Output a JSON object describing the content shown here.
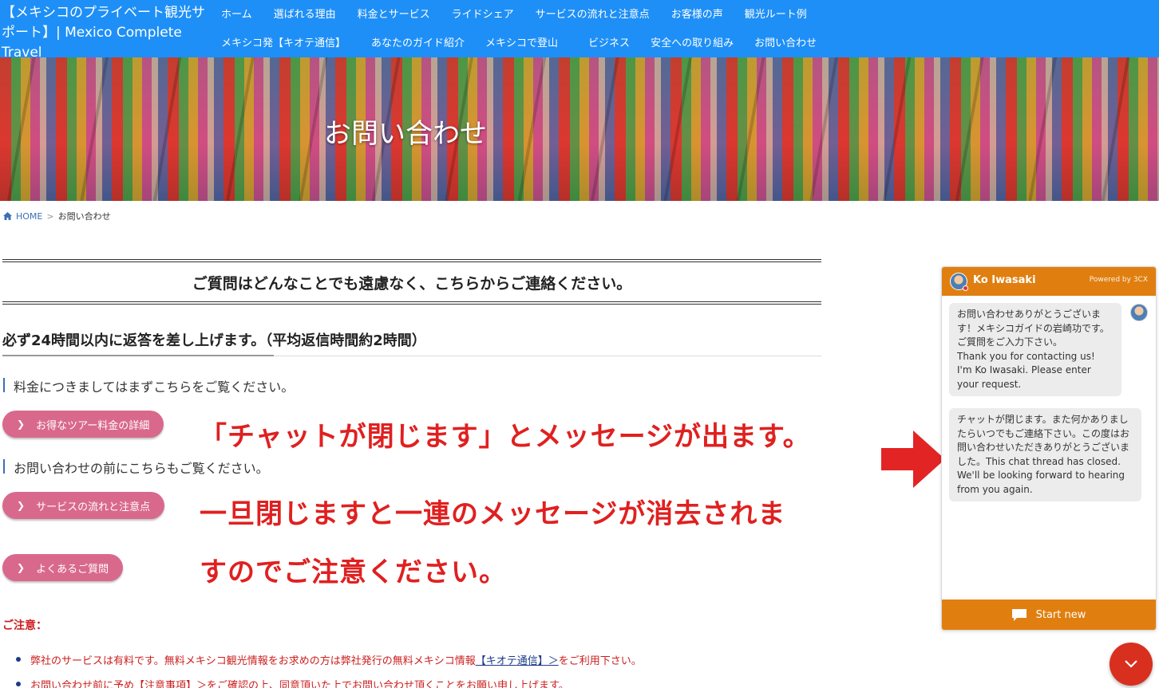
{
  "header": {
    "site_title": "【メキシコのプライベート観光サポート】| Mexico Complete Travel",
    "nav_row1": [
      "ホーム",
      "選ばれる理由",
      "料金とサービス",
      "ライドシェア",
      "サービスの流れと注意点",
      "お客様の声",
      "観光ルート例"
    ],
    "nav_row2": [
      "メキシコ発【キオテ通信】",
      "あなたのガイド紹介",
      "メキシコで登山",
      "ビジネス",
      "安全への取り組み",
      "お問い合わせ"
    ]
  },
  "hero": {
    "title": "お問い合わせ"
  },
  "breadcrumb": {
    "home": "HOME",
    "separator": ">",
    "current": "お問い合わせ"
  },
  "main": {
    "lead": "ご質問はどんなことでも遠慮なく、こちらからご連絡ください。",
    "heading": "必ず24時間以内に返答を差し上げます。（平均返信時間約2時間）",
    "note1": "料金につきましてはまずこちらをご覧ください。",
    "button1": "お得なツアー料金の詳細",
    "note2": "お問い合わせの前にこちらもご覧ください。",
    "button2": "サービスの流れと注意点",
    "button3": "よくあるご質問",
    "caution_title": "ご注意：",
    "bullet1_a": "弊社のサービスは有料です。無料メキシコ観光情報をお求めの方は弊社発行の無料メキシコ情報",
    "bullet1_link": "【キオテ通信】＞",
    "bullet1_b": "をご利用下さい。",
    "bullet2_a": "お問い合わせ前に予め",
    "bullet2_link": "【注意事項】＞",
    "bullet2_b": "をご確認の上、同意頂いた上でお問い合わせ頂くことをお願い申し上げます。"
  },
  "annotation": {
    "line1": "「チャットが閉じます」とメッセージが出ます。",
    "line2": "一旦閉じますと一連のメッセージが消去されま",
    "line3": "すのでご注意ください。"
  },
  "chat": {
    "agent_name": "Ko Iwasaki",
    "powered_by": "Powered by 3CX",
    "message1": "お問い合わせありがとうございます！メキシコガイドの岩崎功です。ご質問をご入力下さい。\nThank you for contacting us!\nI'm Ko Iwasaki. Please enter your request.",
    "message2": "チャットが閉じます。また何かありましたらいつでもご連絡下さい。この度はお問い合わせいただきありがとうございました。This chat thread has closed. We'll be looking forward to hearing from you again.",
    "start_new": "Start new"
  },
  "colors": {
    "header_bg": "#1e8ff7",
    "pill_bg": "#d9698c",
    "chat_accent": "#e07f10",
    "annotation_red": "#e02020",
    "fab_red": "#d92f1e"
  },
  "icons": [
    "home-icon",
    "chevron-right-icon",
    "chat-bubble-icon",
    "chevron-down-icon",
    "arrow-right-icon",
    "agent-avatar-icon"
  ]
}
